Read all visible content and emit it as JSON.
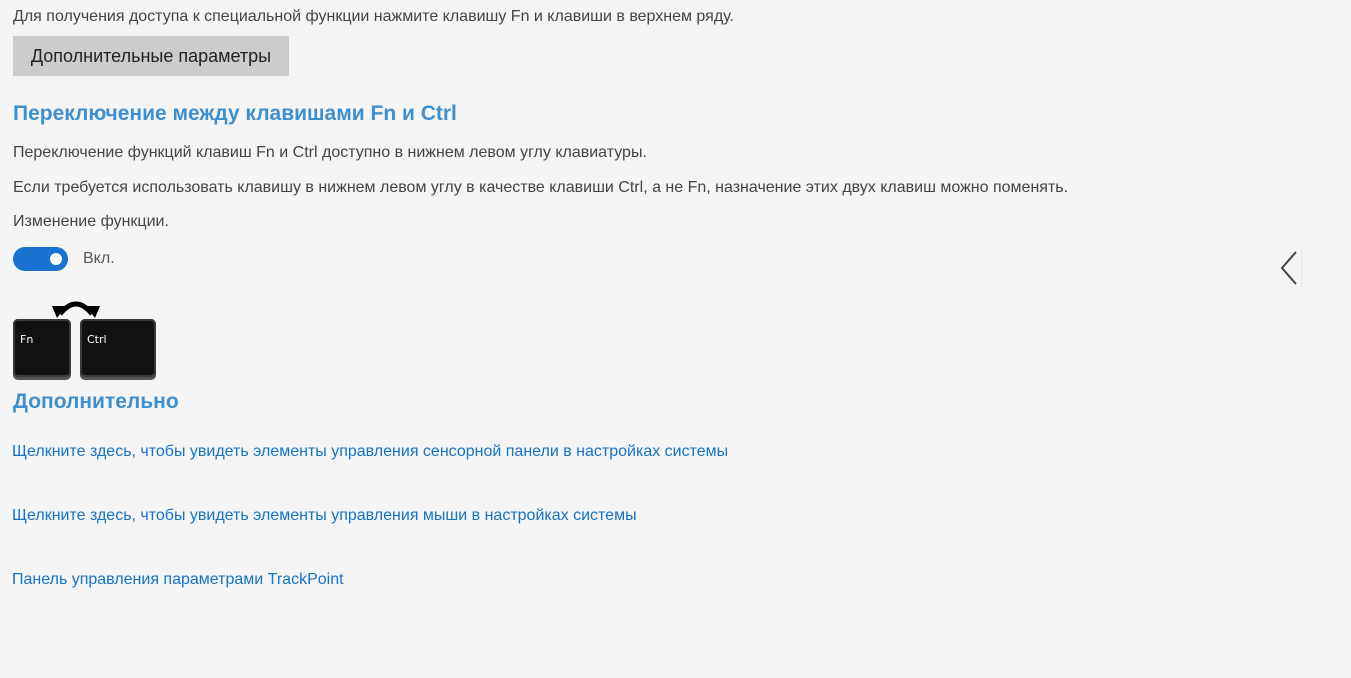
{
  "top_note": "Для получения доступа к специальной функции нажмите клавишу Fn и клавиши в верхнем ряду.",
  "advanced_button": {
    "label": "Дополнительные параметры"
  },
  "fn_ctrl_section": {
    "title": "Переключение между клавишами Fn и Ctrl",
    "paragraph_1": "Переключение функций клавиш Fn и Ctrl доступно в нижнем левом углу клавиатуры.",
    "paragraph_2": "Если требуется использовать клавишу в нижнем левом углу в качестве клавиши Ctrl, а не Fn, назначение этих двух клавиш можно поменять.",
    "change_label": "Изменение функции.",
    "toggle": {
      "state_label": "Вкл."
    },
    "keys": {
      "fn_label": "Fn",
      "ctrl_label": "Ctrl"
    }
  },
  "additional_section": {
    "title": "Дополнительно",
    "links": [
      "Щелкните здесь, чтобы увидеть элементы управления сенсорной панели в настройках системы",
      "Щелкните здесь, чтобы увидеть элементы управления мыши в настройках системы",
      "Панель управления параметрами TrackPoint"
    ]
  },
  "colors": {
    "background": "#f5f5f5",
    "heading": "#3d8fd0",
    "link": "#1672c4",
    "toggle_on": "#1a73d1",
    "button": "#cccccc"
  },
  "icons": {
    "swap": "swap-arrows-icon",
    "chevron": "chevron-left-icon"
  }
}
